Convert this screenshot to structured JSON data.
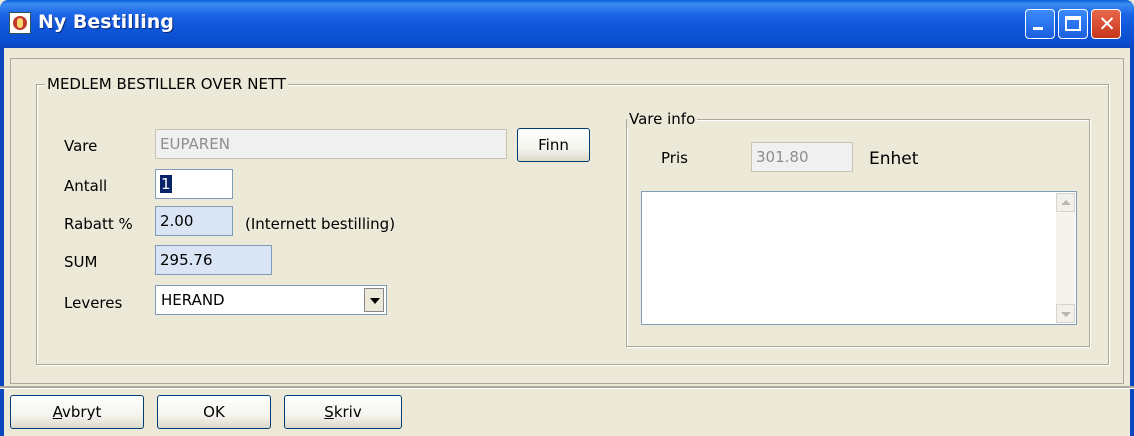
{
  "window": {
    "title": "Ny Bestilling",
    "controls": {
      "minimize_icon": "minimize-icon",
      "maximize_icon": "maximize-icon",
      "close_icon": "close-icon"
    }
  },
  "order_group": {
    "legend": "MEDLEM BESTILLER OVER NETT",
    "vare": {
      "label": "Vare",
      "value": "EUPAREN"
    },
    "find_button": "Finn",
    "antall": {
      "label": "Antall",
      "value": "1"
    },
    "rabatt": {
      "label": "Rabatt %",
      "value": "2.00",
      "note": "(Internett bestilling)"
    },
    "sum": {
      "label": "SUM",
      "value": "295.76"
    },
    "leveres": {
      "label": "Leveres",
      "value": "HERAND"
    }
  },
  "info_group": {
    "legend": "Vare info",
    "pris": {
      "label": "Pris",
      "value": "301.80"
    },
    "unit_label": "Enhet",
    "description": ""
  },
  "buttons": {
    "cancel": {
      "accel": "A",
      "rest": "vbryt"
    },
    "ok": "OK",
    "print": {
      "accel": "S",
      "rest": "kriv"
    }
  },
  "colors": {
    "titlebar": "#0a5fd8",
    "face": "#ece9d8",
    "readonly_field": "#d9e4f5",
    "selection": "#0a246a"
  }
}
